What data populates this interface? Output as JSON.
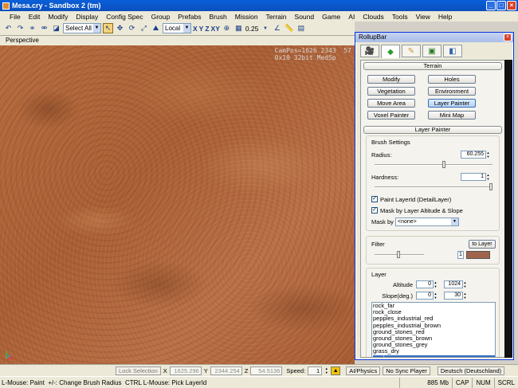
{
  "window": {
    "title": "Mesa.cry - Sandbox 2 (tm)"
  },
  "menu": [
    "File",
    "Edit",
    "Modify",
    "Display",
    "Config Spec",
    "Group",
    "Prefabs",
    "Brush",
    "Mission",
    "Terrain",
    "Sound",
    "Game",
    "AI",
    "Clouds",
    "Tools",
    "View",
    "Help"
  ],
  "toolbar": {
    "select_all": "Select All",
    "coord_system": "Local",
    "axes": [
      "X",
      "Y",
      "Z",
      "XY"
    ],
    "snap": "0.25"
  },
  "viewport": {
    "label": "Perspective",
    "overlay_line1": "CamPos=1626 2343  57",
    "overlay_line2": "0x10 32bit MedSp"
  },
  "rollup": {
    "title": "RollupBar",
    "tabs": [
      "create-icon",
      "terrain-icon",
      "modeling-icon",
      "display-icon",
      "layers-icon"
    ],
    "terrain_header": "Terrain",
    "buttons": [
      "Modify",
      "Holes",
      "Vegetation",
      "Environment",
      "Move Area",
      "Layer Painter",
      "Voxel Painter",
      "Mini Map"
    ],
    "active_button": "Layer Painter",
    "layer_painter_header": "Layer Painter",
    "brush_settings": "Brush Settings",
    "radius_label": "Radius:",
    "radius_value": "60.255",
    "radius_fraction": 0.6,
    "hardness_label": "Hardness:",
    "hardness_value": "1",
    "hardness_fraction": 1.0,
    "paint_layer_label": "Paint LayerId (DetailLayer)",
    "mask_altitude_label": "Mask by Layer Altitude & Slope",
    "mask_by_label": "Mask by",
    "mask_by_value": "<none>",
    "filter_label": "Filter",
    "to_layer_label": "to Layer",
    "filter_value": "1",
    "filter_color": "#a0644a",
    "layer_label": "Layer",
    "altitude_label": "Altitude",
    "altitude_min": "0",
    "altitude_max": "1024",
    "slope_label": "Slope(deg.)",
    "slope_min": "0",
    "slope_max": "30",
    "layers": [
      "rock_far",
      "rock_close",
      "pepples_industrial_red",
      "pepples_industrial_brown",
      "ground_stones_red",
      "ground_stones_brown",
      "ground_stones_grey",
      "grass_dry",
      "mud"
    ],
    "selected_layer": "mud"
  },
  "status1": {
    "lock_selection": "Lock Selection",
    "x_label": "X",
    "x_value": "1625.296",
    "y_label": "Y",
    "y_value": "2344.254",
    "z_label": "Z",
    "z_value": "54.5136",
    "speed_label": "Speed:",
    "speed_value": "1",
    "ai_physics": "AI/Physics",
    "no_sync": "No Sync Player",
    "language": "Deutsch (Deutschland)"
  },
  "status2": {
    "hint": "L-Mouse: Paint  +/-: Change Brush Radius  CTRL L-Mouse: Pick LayerId",
    "memory": "885 Mb",
    "cap": "CAP",
    "num": "NUM",
    "scrl": "SCRL"
  }
}
